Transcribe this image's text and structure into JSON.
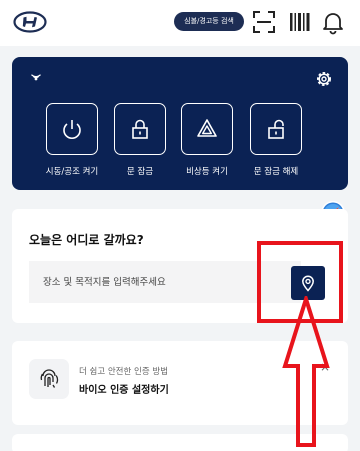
{
  "header": {
    "logo_icon": "hyundai-logo-icon",
    "search_pill_label": "심볼/경고등 검색",
    "icons": [
      "scan-icon",
      "barcode-icon",
      "bell-icon"
    ]
  },
  "remote": {
    "background": "#0b2254",
    "status_icon": "signal-icon",
    "settings_icon": "gear-icon",
    "controls": [
      {
        "label": "시동/공조 켜기",
        "icon": "power-icon"
      },
      {
        "label": "문 잠금",
        "icon": "lock-icon"
      },
      {
        "label": "비상등 켜기",
        "icon": "hazard-icon"
      },
      {
        "label": "문 잠금 해제",
        "icon": "unlock-icon"
      }
    ]
  },
  "destination": {
    "title": "오늘은 어디로 갈까요?",
    "placeholder": "장소 및 목적지를 입력해주세요",
    "location_button_icon": "map-pin-icon"
  },
  "biometric": {
    "subtitle": "더 쉽고 안전한 인증 방법",
    "title": "바이오 인증 설정하기",
    "icon": "fingerprint-icon",
    "close_glyph": "×"
  },
  "highlight_color": "#e8141c"
}
